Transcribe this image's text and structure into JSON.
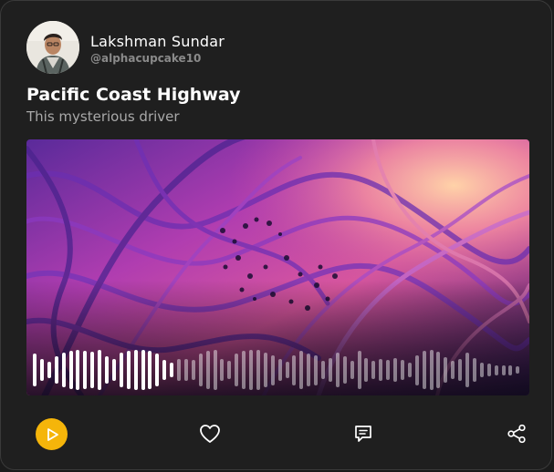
{
  "author": {
    "name": "Lakshman Sundar",
    "handle": "@alphacupcake10"
  },
  "track": {
    "title": "Pacific Coast Highway",
    "subtitle": "This mysterious driver"
  },
  "waveform": {
    "played_fraction": 0.29,
    "levels": [
      0.8,
      0.55,
      0.42,
      0.7,
      0.85,
      0.95,
      1.0,
      0.95,
      0.9,
      1.0,
      0.7,
      0.55,
      0.85,
      0.95,
      1.0,
      1.0,
      0.95,
      0.8,
      0.5,
      0.35,
      0.55,
      0.55,
      0.5,
      0.8,
      0.95,
      1.0,
      0.55,
      0.45,
      0.8,
      0.95,
      1.0,
      1.0,
      0.85,
      0.75,
      0.55,
      0.4,
      0.75,
      0.95,
      0.8,
      0.75,
      0.45,
      0.6,
      0.85,
      0.7,
      0.45,
      0.95,
      0.6,
      0.45,
      0.55,
      0.5,
      0.6,
      0.5,
      0.35,
      0.75,
      0.95,
      1.0,
      0.9,
      0.65,
      0.45,
      0.55,
      0.85,
      0.6,
      0.35,
      0.3,
      0.25,
      0.25,
      0.25,
      0.2
    ]
  },
  "actions": {
    "play": "play-icon",
    "like": "heart-icon",
    "comment": "comment-icon",
    "share": "share-icon"
  },
  "colors": {
    "accent": "#f5b50a",
    "card_bg": "#1f1f1f"
  }
}
